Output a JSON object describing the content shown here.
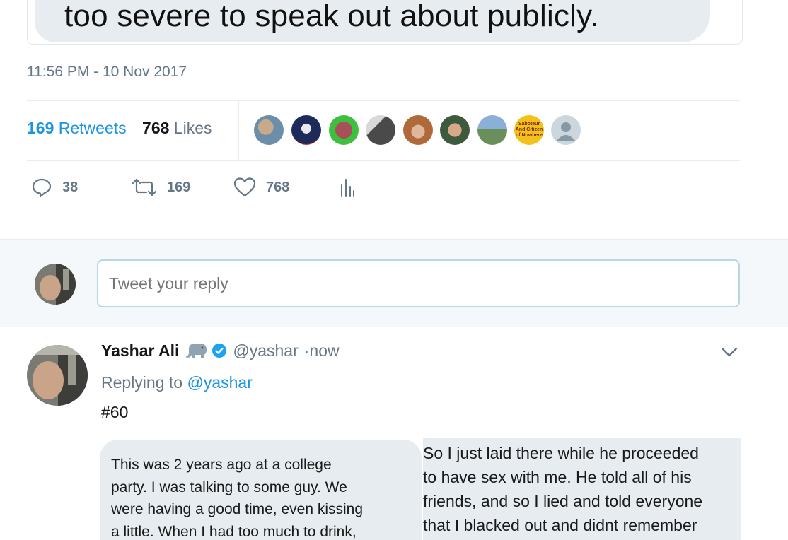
{
  "quoted_tail": "too severe to speak out about publicly.",
  "timestamp": "11:56 PM - 10 Nov 2017",
  "stats": {
    "retweets_count": "169",
    "retweets_label": "Retweets",
    "likes_count": "768",
    "likes_label": "Likes"
  },
  "liker_avatars": [
    {
      "name": "avatar-liker-1",
      "color": "#6b8fa8"
    },
    {
      "name": "avatar-liker-2",
      "color": "#1d2b5a"
    },
    {
      "name": "avatar-liker-3",
      "color": "#3fbf3f"
    },
    {
      "name": "avatar-liker-4",
      "color": "#4a4a4a"
    },
    {
      "name": "avatar-liker-5",
      "color": "#b06a3a"
    },
    {
      "name": "avatar-liker-6",
      "color": "#3d5a3d"
    },
    {
      "name": "avatar-liker-7",
      "color": "#6a8f5a"
    },
    {
      "name": "avatar-liker-8",
      "color": "#f2c21b",
      "text": "Saboteur And Citizen of Nowhere"
    },
    {
      "name": "avatar-liker-9-default",
      "color": "#ccd6dd"
    }
  ],
  "actions": {
    "reply_count": "38",
    "retweet_count": "169",
    "like_count": "768"
  },
  "reply_box": {
    "placeholder": "Tweet your reply"
  },
  "tweet": {
    "name": "Yashar Ali",
    "handle": "@yashar",
    "time": "·now",
    "replying_prefix": "Replying to",
    "replying_handle": "@yashar",
    "text": "#60"
  },
  "screenshot_left": {
    "lines": [
      "This was 2 years ago at a college",
      "party. I was talking to some guy. We",
      "were having a good time, even kissing",
      "a little. When I had too much to drink,"
    ]
  },
  "screenshot_right": {
    "lines": [
      "So I just laid there while he proceeded",
      "to have sex with me.  He told all of his",
      "friends, and so I lied and told everyone",
      "that I blacked out and didnt remember"
    ]
  },
  "colors": {
    "accent": "#1b95e0",
    "muted": "#657786",
    "bubble": "#e6ecf0",
    "verified": "#1da1f2"
  }
}
